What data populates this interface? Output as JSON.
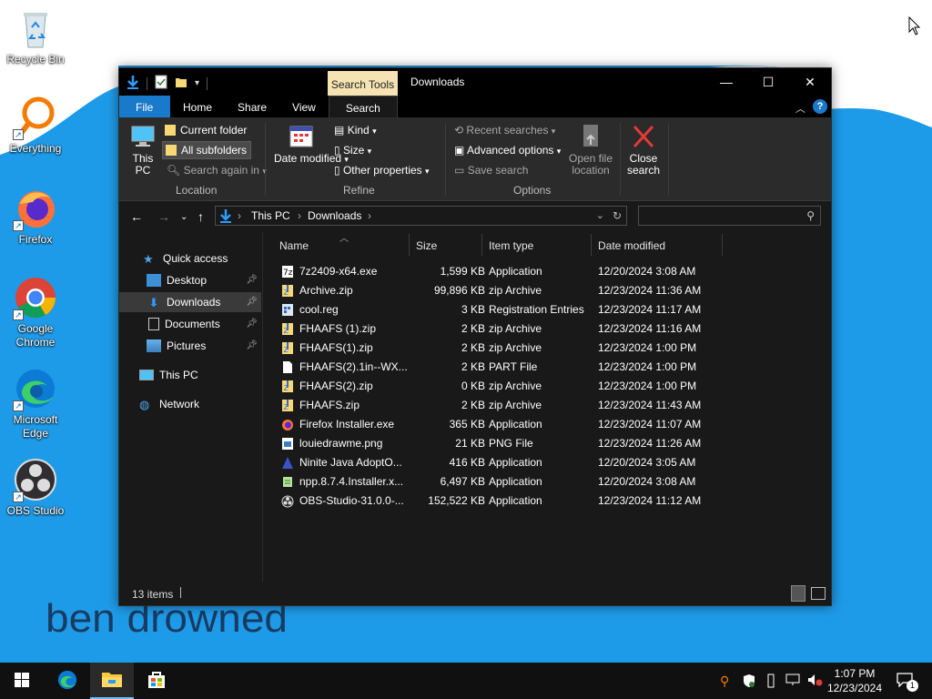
{
  "desktop": {
    "icons": [
      {
        "label": "Recycle Bin",
        "icon": "recycle-bin-icon"
      },
      {
        "label": "Everything",
        "icon": "everything-search-icon"
      },
      {
        "label": "Firefox",
        "icon": "firefox-icon"
      },
      {
        "label": "Google Chrome",
        "icon": "chrome-icon"
      },
      {
        "label": "Microsoft Edge",
        "icon": "edge-icon"
      },
      {
        "label": "OBS Studio",
        "icon": "obs-icon"
      }
    ],
    "wallpaper_text": "ben drowned",
    "colors": {
      "wallpaper_blue": "#1e9be8",
      "wallpaper_white": "#ffffff"
    }
  },
  "window": {
    "title": "Downloads",
    "context_tab": "Search Tools",
    "buttons": {
      "minimize": "—",
      "maximize": "☐",
      "close": "✕"
    }
  },
  "ribbon_tabs": [
    "File",
    "Home",
    "Share",
    "View",
    "Search"
  ],
  "ribbon": {
    "location": {
      "this_pc": "This PC",
      "current_folder": "Current folder",
      "all_subfolders": "All subfolders",
      "search_again_in": "Search again in",
      "group_label": "Location"
    },
    "refine": {
      "date_modified": "Date modified",
      "kind": "Kind",
      "size": "Size",
      "other_properties": "Other properties",
      "group_label": "Refine"
    },
    "options": {
      "recent_searches": "Recent searches",
      "advanced_options": "Advanced options",
      "save_search": "Save search",
      "open_file_location": "Open file location",
      "group_label": "Options"
    },
    "close_search": "Close search"
  },
  "address": {
    "crumbs": [
      "This PC",
      "Downloads"
    ],
    "search_placeholder": ""
  },
  "navpane": {
    "quick_access": "Quick access",
    "items": [
      "Desktop",
      "Downloads",
      "Documents",
      "Pictures"
    ],
    "this_pc": "This PC",
    "network": "Network"
  },
  "columns": [
    "Name",
    "Size",
    "Item type",
    "Date modified"
  ],
  "files": [
    {
      "name": "7z2409-x64.exe",
      "size": "1,599 KB",
      "type": "Application",
      "date": "12/20/2024 3:08 AM",
      "icon": "7zip-icon"
    },
    {
      "name": "Archive.zip",
      "size": "99,896 KB",
      "type": "zip Archive",
      "date": "12/23/2024 11:36 AM",
      "icon": "zip-icon"
    },
    {
      "name": "cool.reg",
      "size": "3 KB",
      "type": "Registration Entries",
      "date": "12/23/2024 11:17 AM",
      "icon": "reg-icon"
    },
    {
      "name": "FHAAFS (1).zip",
      "size": "2 KB",
      "type": "zip Archive",
      "date": "12/23/2024 11:16 AM",
      "icon": "zip-icon"
    },
    {
      "name": "FHAAFS(1).zip",
      "size": "2 KB",
      "type": "zip Archive",
      "date": "12/23/2024 1:00 PM",
      "icon": "zip-icon"
    },
    {
      "name": "FHAAFS(2).1in--WX...",
      "size": "2 KB",
      "type": "PART File",
      "date": "12/23/2024 1:00 PM",
      "icon": "file-icon"
    },
    {
      "name": "FHAAFS(2).zip",
      "size": "0 KB",
      "type": "zip Archive",
      "date": "12/23/2024 1:00 PM",
      "icon": "zip-icon"
    },
    {
      "name": "FHAAFS.zip",
      "size": "2 KB",
      "type": "zip Archive",
      "date": "12/23/2024 11:43 AM",
      "icon": "zip-icon"
    },
    {
      "name": "Firefox Installer.exe",
      "size": "365 KB",
      "type": "Application",
      "date": "12/23/2024 11:07 AM",
      "icon": "firefox-icon"
    },
    {
      "name": "louiedrawme.png",
      "size": "21 KB",
      "type": "PNG File",
      "date": "12/23/2024 11:26 AM",
      "icon": "image-icon"
    },
    {
      "name": "Ninite Java AdoptO...",
      "size": "416 KB",
      "type": "Application",
      "date": "12/20/2024 3:05 AM",
      "icon": "ninite-icon"
    },
    {
      "name": "npp.8.7.4.Installer.x...",
      "size": "6,497 KB",
      "type": "Application",
      "date": "12/20/2024 3:08 AM",
      "icon": "notepadpp-icon"
    },
    {
      "name": "OBS-Studio-31.0.0-...",
      "size": "152,522 KB",
      "type": "Application",
      "date": "12/23/2024 11:12 AM",
      "icon": "obs-icon"
    }
  ],
  "status": {
    "count": "13 items"
  },
  "taskbar": {
    "time": "1:07 PM",
    "date": "12/23/2024",
    "notification_count": "1"
  }
}
